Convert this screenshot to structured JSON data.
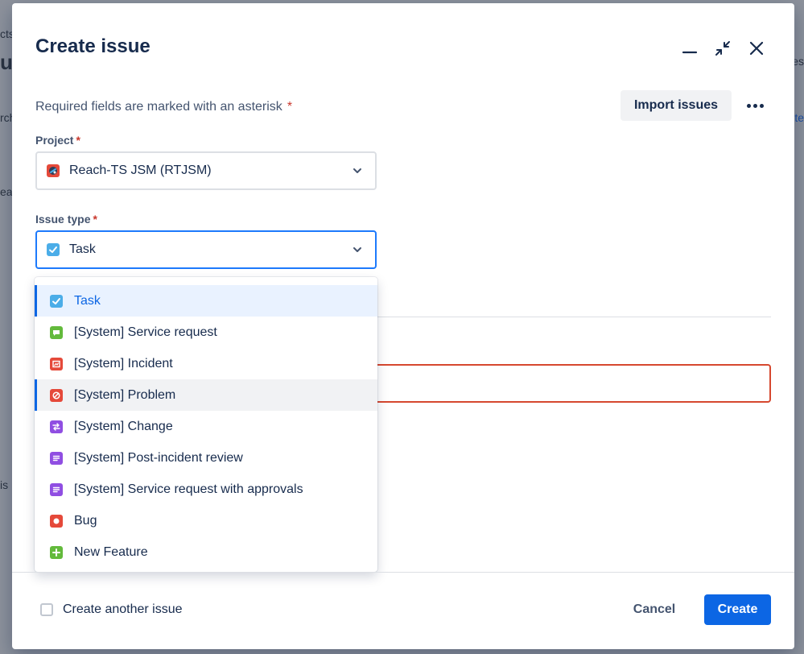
{
  "background": {
    "fragments": [
      "cts",
      "ue",
      "rch",
      "ea",
      "is",
      "es",
      "te"
    ]
  },
  "modal": {
    "title": "Create issue",
    "required_note": "Required fields are marked with an asterisk",
    "asterisk": "*",
    "import_button": "Import issues",
    "header_icons": [
      "minimize-icon",
      "collapse-icon",
      "close-icon"
    ]
  },
  "fields": {
    "project": {
      "label": "Project",
      "value": "Reach-TS JSM (RTJSM)"
    },
    "issue_type": {
      "label": "Issue type",
      "value": "Task"
    }
  },
  "dropdown": {
    "options": [
      {
        "label": "Task",
        "icon": "task-icon",
        "color": "#4bade8",
        "state": "selected"
      },
      {
        "label": "[System] Service request",
        "icon": "service-request-icon",
        "color": "#63ba3c",
        "state": ""
      },
      {
        "label": "[System] Incident",
        "icon": "incident-icon",
        "color": "#e5493a",
        "state": ""
      },
      {
        "label": "[System] Problem",
        "icon": "problem-icon",
        "color": "#e5493a",
        "state": "hover"
      },
      {
        "label": "[System] Change",
        "icon": "change-icon",
        "color": "#904ee2",
        "state": ""
      },
      {
        "label": "[System] Post-incident review",
        "icon": "post-incident-review-icon",
        "color": "#904ee2",
        "state": ""
      },
      {
        "label": "[System] Service request with approvals",
        "icon": "service-request-approvals-icon",
        "color": "#904ee2",
        "state": ""
      },
      {
        "label": "Bug",
        "icon": "bug-icon",
        "color": "#e5493a",
        "state": ""
      },
      {
        "label": "New Feature",
        "icon": "new-feature-icon",
        "color": "#63ba3c",
        "state": ""
      }
    ]
  },
  "footer": {
    "create_another": "Create another issue",
    "cancel": "Cancel",
    "create": "Create"
  },
  "colors": {
    "primary": "#0c66e4",
    "required": "#c9372c",
    "error_border": "#d6482f"
  }
}
